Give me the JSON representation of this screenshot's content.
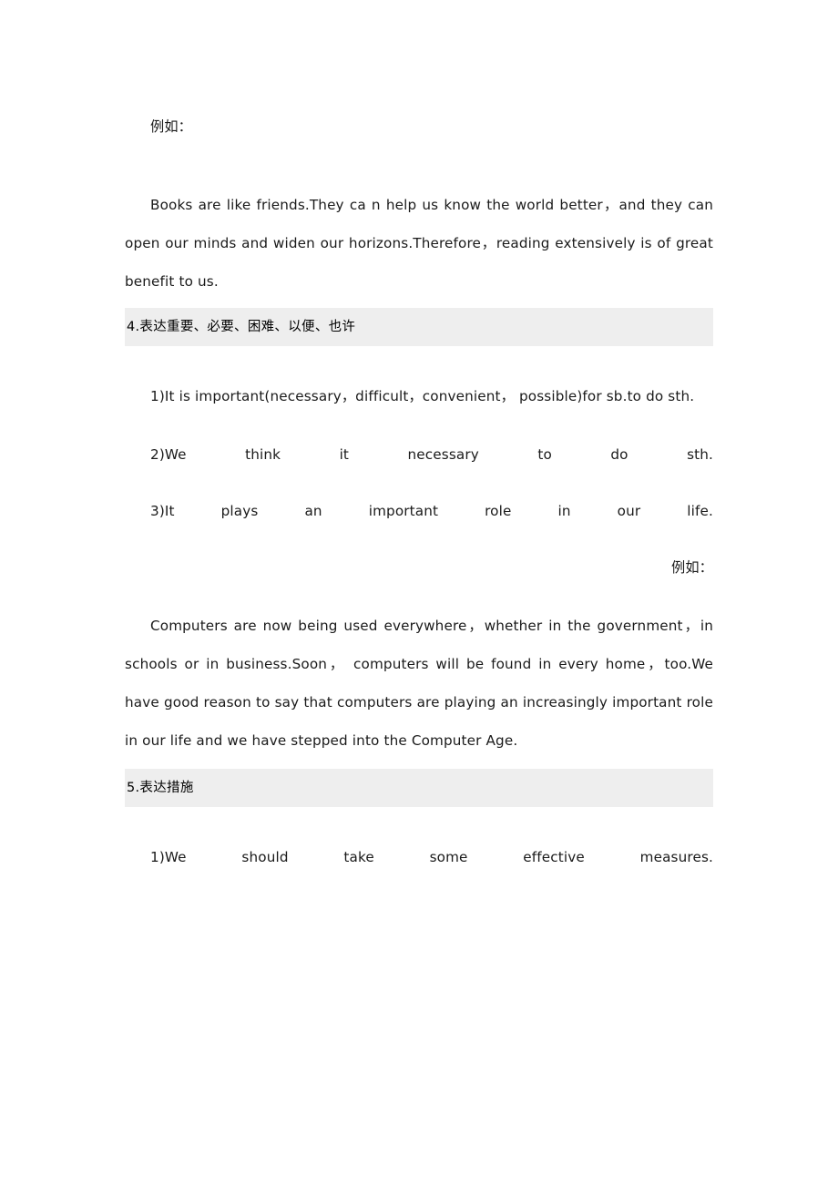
{
  "document": {
    "background_color": "#ffffff",
    "text_color": "#1a1a1a",
    "section_bar_color": "#eeeeee",
    "blocks": {
      "example_label_top": "例如：",
      "example_paragraph_books": "Books are like friends.They ca n help us know the world better，and they can open our minds and widen our horizons.Therefore，reading extensively is of great benefit to us.",
      "section_heading_4": "4.表达重要、必要、困难、以便、也许",
      "item_4_1": "1)It is important(necessary，difficult，convenient， possible)for sb.to do sth.",
      "item_4_2": "2)We think it necessary to do sth.",
      "item_4_3": "3)It plays an important role in our life.",
      "example_label_middle": "例如：",
      "example_paragraph_computers": "Computers are now being used everywhere，whether in the government，in schools or in business.Soon， computers will be found in every home，too.We have good reason to say that computers are playing an increasingly important role in our life and we have stepped into the Computer Age.",
      "section_heading_5": "5.表达措施",
      "item_5_1": "1)We should take some effective measures."
    }
  }
}
